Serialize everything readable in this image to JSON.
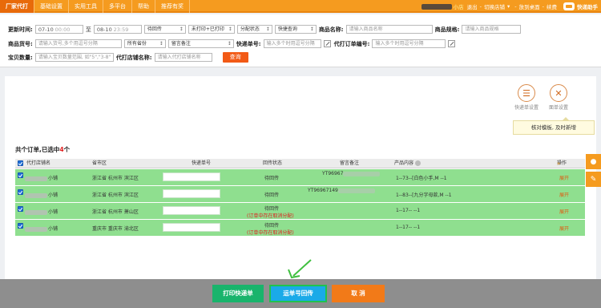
{
  "topnav": {
    "items": [
      {
        "label": "厂家代打",
        "active": true
      },
      {
        "label": "基础设置",
        "active": false
      },
      {
        "label": "实用工具",
        "active": false
      },
      {
        "label": "多平台",
        "active": false
      },
      {
        "label": "帮助",
        "active": false
      },
      {
        "label": "推荐有奖",
        "active": false
      }
    ]
  },
  "topright": {
    "shop": "小店",
    "logout": "退出",
    "switch_shop": "切换店铺",
    "desktop": "放到桌面",
    "renew": "续费",
    "brand": "快递助手"
  },
  "filters": {
    "update_time_label": "更新时间:",
    "start_date": "07-10",
    "start_time": "00:00",
    "to": "至",
    "end_date": "08-10",
    "end_time": "23:59",
    "return_status": "待回传",
    "print_status": "未打印+已打印",
    "alloc_status": "分配状态",
    "quick_query": "快捷查询",
    "product_name_label": "商品名称:",
    "product_name_placeholder": "请输入商品名称",
    "product_spec_label": "商品规格:",
    "product_spec_placeholder": "请输入商品规格",
    "product_no_label": "商品货号:",
    "product_no_placeholder": "请输入货号,多个用逗号分隔",
    "province": "所有省份",
    "remark": "留言备注",
    "express_no_label": "快递单号:",
    "express_no_placeholder": "输入多个时用逗号分隔",
    "order_no_label": "代打订单编号:",
    "order_no_placeholder": "输入多个时用逗号分隔",
    "qty_label": "宝贝数量:",
    "qty_placeholder": "请输入宝贝数量范围, 如\"5\",\"3-8\"",
    "shop_label": "代打店铺名称:",
    "shop_placeholder": "请输入代打店铺名称",
    "query_button": "查询"
  },
  "tools": {
    "express_settings": "快递单设置",
    "mail_settings": "面单设置",
    "tooltip": "核对模板, 及时新增"
  },
  "summary": {
    "prefix": "共个订单,已选中",
    "selected": "4",
    "suffix": "个"
  },
  "table": {
    "headers": {
      "shop": "代打店铺名",
      "region": "省市区",
      "express_no": "快递单号",
      "status": "回传状态",
      "remark": "留言备注",
      "content": "产品内容",
      "action": "操作"
    },
    "rows": [
      {
        "shop": "小铺",
        "region": "浙江省 杭州市 滨江区",
        "status": "待回传",
        "warning": "",
        "remark": "YT96967",
        "content": "1--73--[白色小手,M --1",
        "action": "展开"
      },
      {
        "shop": "小铺",
        "region": "浙江省 杭州市 滨江区",
        "status": "待回传",
        "warning": "",
        "remark": "YT96967149",
        "content": "1--83--[九分字母款,M --1",
        "action": "展开"
      },
      {
        "shop": "小铺",
        "region": "浙江省 杭州市 萧山区",
        "status": "待回传",
        "warning": "(订单中存在取消分配)",
        "remark": "",
        "content": "1--17-- --1",
        "action": "展开"
      },
      {
        "shop": "小铺",
        "region": "重庆市 重庆市 渝北区",
        "status": "待回传",
        "warning": "(订单中存在取消分配)",
        "remark": "",
        "content": "1--17-- --1",
        "action": "展开"
      }
    ]
  },
  "bottom": {
    "print": "打印快递单",
    "return": "运单号回传",
    "cancel": "取 消"
  },
  "colors": {
    "brand_orange": "#f59b1f",
    "row_green": "#8fdf8f",
    "print_green": "#19b46c",
    "return_blue": "#1aaae8",
    "cancel_orange": "#f27a18"
  }
}
